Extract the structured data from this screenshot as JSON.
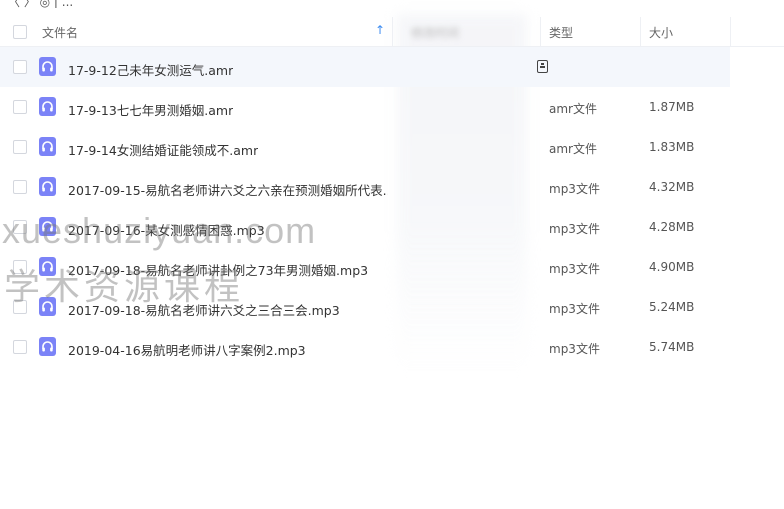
{
  "breadcrumb": {
    "text": "〈  〉  ◎  |  ..."
  },
  "header": {
    "col_name": "文件名",
    "col_modified": "修改时间",
    "col_type": "类型",
    "col_size": "大小"
  },
  "files": [
    {
      "name": "17-9-12己未年女测运气.amr",
      "type": "",
      "size": ""
    },
    {
      "name": "17-9-13七七年男测婚姻.amr",
      "type": "amr文件",
      "size": "1.87MB"
    },
    {
      "name": "17-9-14女测结婚证能领成不.amr",
      "type": "amr文件",
      "size": "1.83MB"
    },
    {
      "name": "2017-09-15-易航名老师讲六爻之六亲在预测婚姻所代表...",
      "type": "mp3文件",
      "size": "4.32MB"
    },
    {
      "name": "2017-09-16-某女测感情困惑.mp3",
      "type": "mp3文件",
      "size": "4.28MB"
    },
    {
      "name": "2017-09-18-易航名老师讲卦例之73年男测婚姻.mp3",
      "type": "mp3文件",
      "size": "4.90MB"
    },
    {
      "name": "2017-09-18-易航名老师讲六爻之三合三会.mp3",
      "type": "mp3文件",
      "size": "5.24MB"
    },
    {
      "name": "2019-04-16易航明老师讲八字案例2.mp3",
      "type": "mp3文件",
      "size": "5.74MB"
    }
  ],
  "watermark": {
    "line1": "xueshuziyuan.com",
    "line2": "学术资源课程"
  },
  "colors": {
    "audio_icon": "#7b83f7",
    "sort_arrow": "#3d8cf0",
    "selected_row": "#f4f7fc"
  }
}
